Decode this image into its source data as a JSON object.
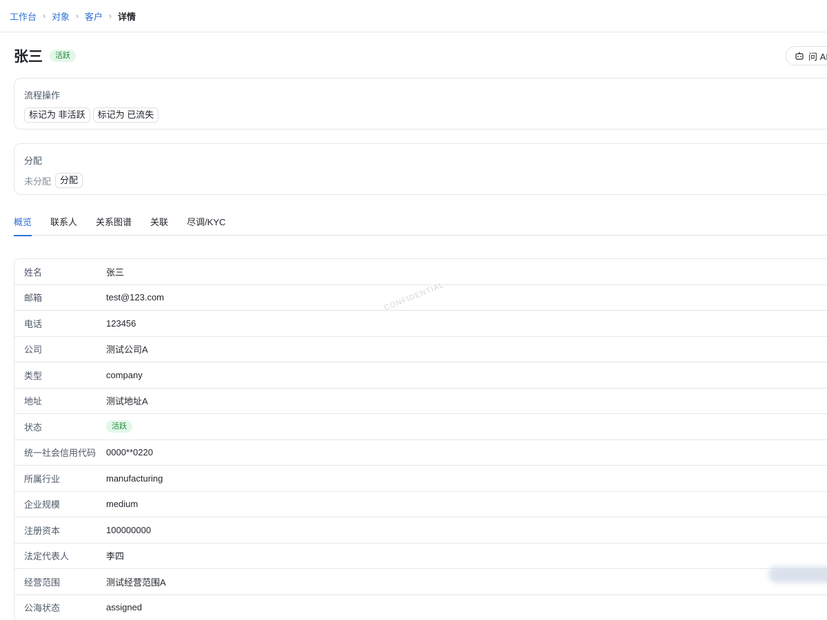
{
  "breadcrumb": {
    "items": [
      "工作台",
      "对象",
      "客户"
    ],
    "current": "详情"
  },
  "header": {
    "title": "张三",
    "status_badge": "活跃",
    "ask_ai_label": "问 AI"
  },
  "process_card": {
    "title": "流程操作",
    "actions": [
      "标记为 非活跃",
      "标记为 已流失"
    ]
  },
  "assign_card": {
    "title": "分配",
    "status_text": "未分配",
    "assign_button": "分配"
  },
  "tabs": [
    "概览",
    "联系人",
    "关系图谱",
    "关联",
    "尽调/KYC"
  ],
  "active_tab": "概览",
  "details": {
    "rows": [
      {
        "label": "姓名",
        "value": "张三"
      },
      {
        "label": "邮箱",
        "value": "test@123.com"
      },
      {
        "label": "电话",
        "value": "123456"
      },
      {
        "label": "公司",
        "value": "测试公司A"
      },
      {
        "label": "类型",
        "value": "company"
      },
      {
        "label": "地址",
        "value": "测试地址A"
      },
      {
        "label": "状态",
        "value": "活跃"
      },
      {
        "label": "统一社会信用代码",
        "value": "0000**0220"
      },
      {
        "label": "所属行业",
        "value": "manufacturing"
      },
      {
        "label": "企业规模",
        "value": "medium"
      },
      {
        "label": "注册资本",
        "value": "100000000"
      },
      {
        "label": "法定代表人",
        "value": "李四"
      },
      {
        "label": "经营范围",
        "value": "测试经营范围A"
      },
      {
        "label": "公海状态",
        "value": "assigned"
      }
    ]
  },
  "watermark": "CONFIDENTIAL",
  "colors": {
    "accent": "#2f6fd6",
    "active_badge_bg": "#e3f7e8",
    "active_badge_text": "#1f8a3b",
    "border": "#e5e6eb"
  }
}
